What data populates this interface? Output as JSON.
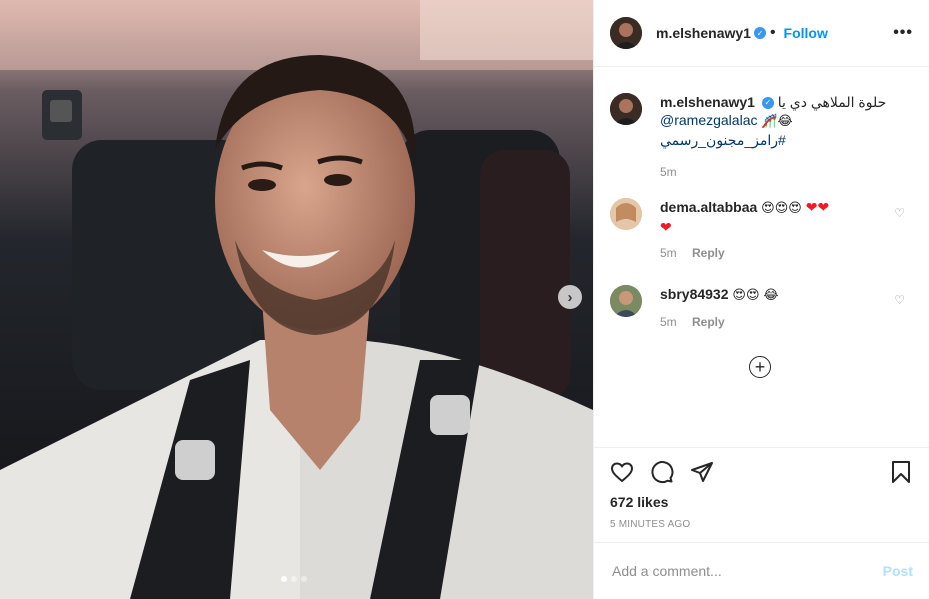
{
  "post": {
    "username": "m.elshenawy1",
    "follow_label": "Follow",
    "more_label": "•••",
    "caption_text": "حلوة الملاهي دي يا",
    "caption_mention": "@ramezgalalac",
    "caption_hashtag": "#رامز_مجنون_رسمي",
    "caption_time": "5m",
    "likes": "672 likes",
    "time_ago": "5 MINUTES AGO"
  },
  "comments": [
    {
      "username": "dema.altabbaa",
      "emojis": "😍😍😍",
      "time": "5m",
      "reply_label": "Reply"
    },
    {
      "username": "sbry84932",
      "emojis": "😍😍",
      "time": "5m",
      "reply_label": "Reply"
    }
  ],
  "composer": {
    "placeholder": "Add a comment...",
    "post_label": "Post"
  },
  "colors": {
    "accent": "#0095f6",
    "verified": "#3897f0",
    "heart": "#ed1c24"
  },
  "icons": [
    "verified-badge-icon",
    "more-options-icon",
    "heart-icon",
    "comment-icon",
    "share-icon",
    "bookmark-icon",
    "plus-circle-icon",
    "chevron-right-icon"
  ],
  "carousel": {
    "dot_count": 3,
    "active_index": 0
  }
}
